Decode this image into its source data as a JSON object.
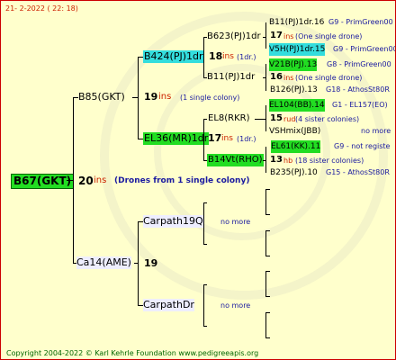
{
  "header": {
    "text": "21-   2-2022  (  22:  18)"
  },
  "root": {
    "name": "B67(GKT)",
    "num": "20",
    "ins": "ins",
    "desc": "(Drones from 1 single colony)"
  },
  "gen1": {
    "a": {
      "name": "B85(GKT)",
      "num": "19",
      "ins": "ins",
      "desc": "(1 single colony)"
    },
    "b": {
      "name": "Ca14(AME)",
      "num": "19"
    }
  },
  "gen2": {
    "a": {
      "name": "B424(PJ)1dr",
      "num": "18",
      "ins": "ins",
      "desc": "(1dr.)"
    },
    "b": {
      "name": "EL36(MR)1dr",
      "num": "17",
      "ins": "ins",
      "desc": "(1dr.)"
    },
    "c": {
      "name": "Carpath19Q",
      "desc": "no more"
    },
    "d": {
      "name": "CarpathDr",
      "desc": "no more"
    }
  },
  "gen3": {
    "a": {
      "name": "B623(PJ)1dr"
    },
    "b": {
      "name": "B11(PJ)1dr"
    },
    "c": {
      "name": "EL8(RKR)"
    },
    "d": {
      "name": "B14Vt(RHO)"
    }
  },
  "gen4": {
    "l1": {
      "name": "B11(PJ)1dr.16",
      "info": "G9 - PrimGreen00"
    },
    "l2": {
      "num": "17",
      "ins": "ins",
      "desc": "(One single drone)"
    },
    "l3": {
      "name": "V5H(PJ)1dr.15",
      "info": "G9 - PrimGreen00"
    },
    "l4": {
      "name": "V21B(PJ).13",
      "info": "G8 - PrimGreen00"
    },
    "l5": {
      "num": "16",
      "ins": "ins",
      "desc": "(One single drone)"
    },
    "l6": {
      "name": "B126(PJ).13",
      "info": "G18 - AthosSt80R"
    },
    "l7": {
      "name": "EL104(BB).14",
      "info": "G1 - EL157(EO)"
    },
    "l8": {
      "num": "15",
      "ins": "rud",
      "desc": "(4 sister colonies)"
    },
    "l9": {
      "name": "VSHmix(JBB)",
      "info": "no more"
    },
    "l10": {
      "name": "EL61(KK).11",
      "info": "G9 - not registe"
    },
    "l11": {
      "num": "13",
      "ins": "hb",
      "desc": "(18 sister colonies)"
    },
    "l12": {
      "name": "B235(PJ).10",
      "info": "G15 - AthosSt80R"
    }
  },
  "footer": {
    "text": "Copyright 2004-2022 © Karl Kehrle Foundation    www.pedigreeapis.org"
  }
}
